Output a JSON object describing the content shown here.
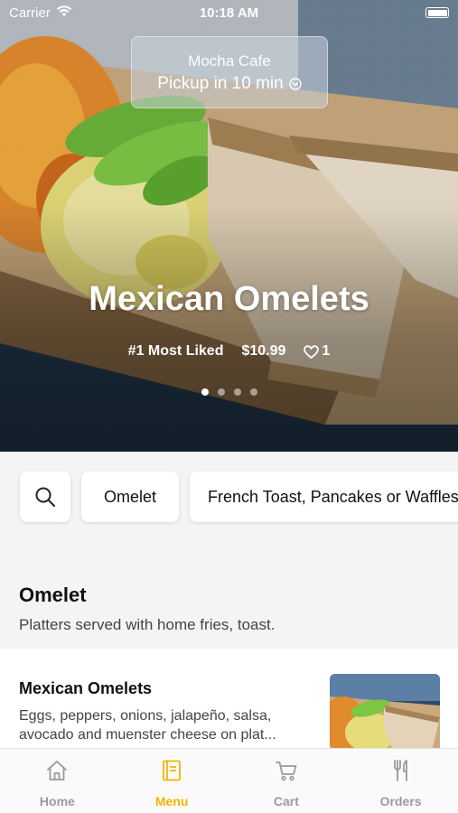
{
  "status_bar": {
    "carrier": "Carrier",
    "time": "10:18 AM"
  },
  "pickup": {
    "cafe_name": "Mocha Cafe",
    "pickup_text": "Pickup in 10 min"
  },
  "hero": {
    "title": "Mexican Omelets",
    "badge": "#1 Most Liked",
    "price": "$10.99",
    "likes": "1",
    "carousel": {
      "count": 4,
      "active_index": 0
    }
  },
  "filters": {
    "omelet": "Omelet",
    "french_toast": "French Toast, Pancakes or Waffles"
  },
  "section": {
    "title": "Omelet",
    "subtitle": "Platters served with home fries, toast."
  },
  "menu_item": {
    "name": "Mexican Omelets",
    "description": "Eggs, peppers, onions, jalapeño, salsa, avocado and muenster cheese on plat..."
  },
  "tabs": [
    {
      "label": "Home",
      "icon": "home-icon",
      "active": false
    },
    {
      "label": "Menu",
      "icon": "menu-book-icon",
      "active": true
    },
    {
      "label": "Cart",
      "icon": "cart-icon",
      "active": false
    },
    {
      "label": "Orders",
      "icon": "fork-knife-icon",
      "active": false
    }
  ],
  "colors": {
    "accent": "#f5b400",
    "inactive": "#9a9a9a"
  }
}
